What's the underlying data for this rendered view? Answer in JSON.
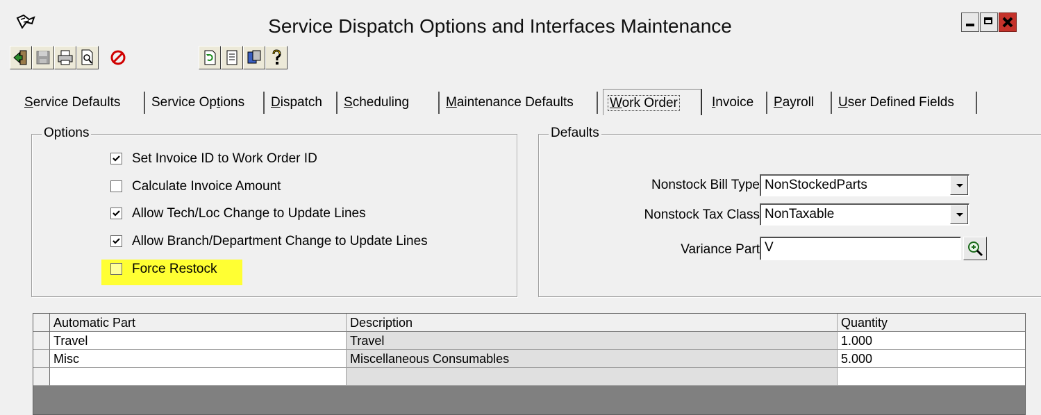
{
  "window": {
    "title": "Service Dispatch Options and Interfaces Maintenance"
  },
  "toolbar": {
    "buttons": [
      {
        "name": "exit-icon"
      },
      {
        "name": "save-icon"
      },
      {
        "name": "print-icon"
      },
      {
        "name": "print-preview-icon"
      },
      {
        "name": "cancel-icon"
      },
      {
        "name": "refresh-icon"
      },
      {
        "name": "notes-icon"
      },
      {
        "name": "interfaces-icon"
      },
      {
        "name": "help-icon"
      }
    ]
  },
  "tabs": [
    {
      "pre": "",
      "key": "S",
      "post": "ervice Defaults",
      "active": false
    },
    {
      "pre": "Service Op",
      "key": "t",
      "post": "ions",
      "active": false
    },
    {
      "pre": "",
      "key": "D",
      "post": "ispatch",
      "active": false
    },
    {
      "pre": "",
      "key": "S",
      "post": "cheduling",
      "active": false
    },
    {
      "pre": "",
      "key": "M",
      "post": "aintenance Defaults",
      "active": false
    },
    {
      "pre": "",
      "key": "W",
      "post": "ork Order",
      "active": true
    },
    {
      "pre": "",
      "key": "I",
      "post": "nvoice",
      "active": false
    },
    {
      "pre": "",
      "key": "P",
      "post": "ayroll",
      "active": false
    },
    {
      "pre": "",
      "key": "U",
      "post": "ser Defined Fields",
      "active": false
    }
  ],
  "options": {
    "title": "Options",
    "items": [
      {
        "label": "Set Invoice ID to Work Order ID",
        "checked": true
      },
      {
        "label": "Calculate Invoice Amount",
        "checked": false
      },
      {
        "label": "Allow Tech/Loc Change to Update Lines",
        "checked": true
      },
      {
        "label": "Allow Branch/Department Change to Update Lines",
        "checked": true
      },
      {
        "label": "Force Restock",
        "checked": false
      }
    ],
    "highlight_color": "#ffff33"
  },
  "defaults": {
    "title": "Defaults",
    "bill_type": {
      "label": "Nonstock Bill Type",
      "value": "NonStockedParts"
    },
    "tax_class": {
      "label": "Nonstock Tax Class",
      "value": "NonTaxable"
    },
    "variance_part": {
      "label": "Variance Part",
      "value": "V"
    }
  },
  "grid": {
    "columns": [
      "Automatic Part",
      "Description",
      "Quantity"
    ],
    "rows": [
      {
        "part": "Travel",
        "description": "Travel",
        "quantity": "1.000"
      },
      {
        "part": "Misc",
        "description": "Miscellaneous Consumables",
        "quantity": "5.000"
      },
      {
        "part": "",
        "description": "",
        "quantity": ""
      }
    ]
  },
  "colors": {
    "close_button": "#c4322b",
    "face": "#f0f0f0"
  }
}
